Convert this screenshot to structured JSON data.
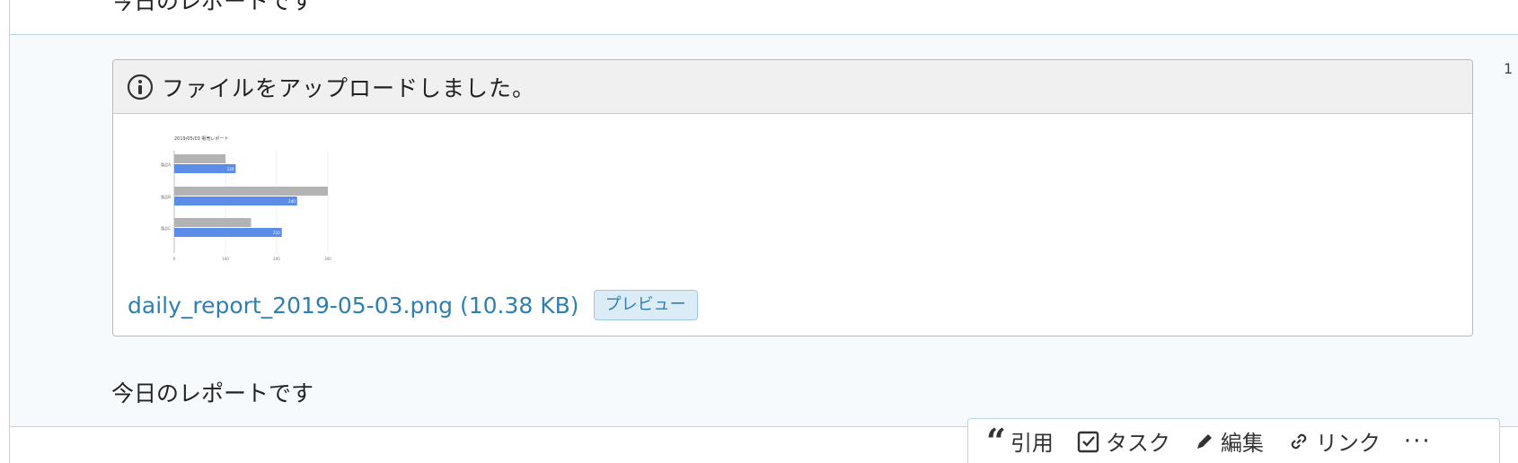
{
  "previous_message": {
    "text": "今日のレポートです"
  },
  "message": {
    "timestamp": "1",
    "notice": {
      "title": "ファイルをアップロードしました。",
      "icon": "info-icon"
    },
    "thumbnail": {
      "title": "2019/05/03 販売レポート",
      "categories": [
        "製品A",
        "製品B",
        "製品C"
      ],
      "series": [
        {
          "color": "#b3b3b3",
          "values": [
            100,
            300,
            150
          ]
        },
        {
          "color": "#5b8de8",
          "values": [
            120,
            240,
            210
          ],
          "labels": [
            "120",
            "240",
            "210"
          ]
        }
      ],
      "xticks": [
        "0",
        "100",
        "200",
        "300"
      ],
      "xmax": 300
    },
    "attachment": {
      "link_text": "daily_report_2019-05-03.png (10.38 KB)",
      "preview_label": "プレビュー"
    },
    "body": "今日のレポートです"
  },
  "actions": {
    "quote": "引用",
    "task": "タスク",
    "edit": "編集",
    "link": "リンク",
    "more": "···"
  },
  "colors": {
    "link": "#2f7fb0",
    "divider": "#b7d7e8",
    "message_bg": "#f7fafd"
  }
}
